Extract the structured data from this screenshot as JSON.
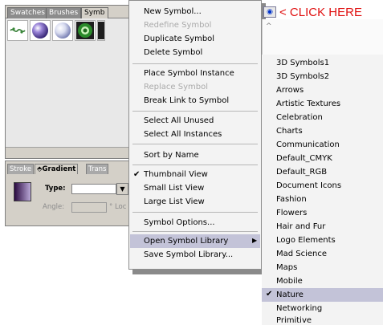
{
  "symbols_panel": {
    "tabs": [
      "Swatches",
      "Brushes",
      "Symb"
    ]
  },
  "gradient_panel": {
    "tabs": [
      {
        "label": "Stroke"
      },
      {
        "label": "⬘Gradient",
        "active": true
      },
      {
        "label": "Trans"
      }
    ],
    "type_label": "Type:",
    "angle_label": "Angle:",
    "location_label": "° Loc"
  },
  "menu": {
    "items": [
      {
        "label": "New Symbol...",
        "disabled": false
      },
      {
        "label": "Redefine Symbol",
        "disabled": true
      },
      {
        "label": "Duplicate Symbol",
        "disabled": false
      },
      {
        "label": "Delete Symbol",
        "disabled": false
      },
      {
        "label": "Place Symbol Instance",
        "disabled": false
      },
      {
        "label": "Replace Symbol",
        "disabled": true
      },
      {
        "label": "Break Link to Symbol",
        "disabled": false
      },
      {
        "label": "Select All Unused",
        "disabled": false
      },
      {
        "label": "Select All Instances",
        "disabled": false
      },
      {
        "label": "Sort by Name",
        "disabled": false
      },
      {
        "label": "Thumbnail View",
        "disabled": false,
        "checked": true
      },
      {
        "label": "Small List View",
        "disabled": false
      },
      {
        "label": "Large List View",
        "disabled": false
      },
      {
        "label": "Symbol Options...",
        "disabled": false
      },
      {
        "label": "Open Symbol Library",
        "disabled": false,
        "highlighted": true,
        "has_submenu": true
      },
      {
        "label": "Save Symbol Library...",
        "disabled": false
      }
    ],
    "check_glyph": "✔",
    "submenu_arrow": "▶"
  },
  "library_submenu": {
    "items": [
      {
        "label": "3D Symbols1"
      },
      {
        "label": "3D Symbols2"
      },
      {
        "label": "Arrows"
      },
      {
        "label": "Artistic Textures"
      },
      {
        "label": "Celebration"
      },
      {
        "label": "Charts"
      },
      {
        "label": "Communication"
      },
      {
        "label": "Default_CMYK"
      },
      {
        "label": "Default_RGB"
      },
      {
        "label": "Document Icons"
      },
      {
        "label": "Fashion"
      },
      {
        "label": "Flowers"
      },
      {
        "label": "Hair and Fur"
      },
      {
        "label": "Logo Elements"
      },
      {
        "label": "Mad Science"
      },
      {
        "label": "Maps"
      },
      {
        "label": "Mobile"
      },
      {
        "label": "Nature",
        "checked": true,
        "highlighted": true
      },
      {
        "label": "Networking"
      },
      {
        "label": "Primitive"
      }
    ]
  },
  "callout": {
    "text": "< CLICK HERE",
    "color": "#e01010"
  },
  "colors": {
    "panel_bg": "#d4d0c8",
    "menu_bg": "#f3f3f3",
    "highlight": "#c3c3d8",
    "disabled_text": "#aaaaaa"
  }
}
